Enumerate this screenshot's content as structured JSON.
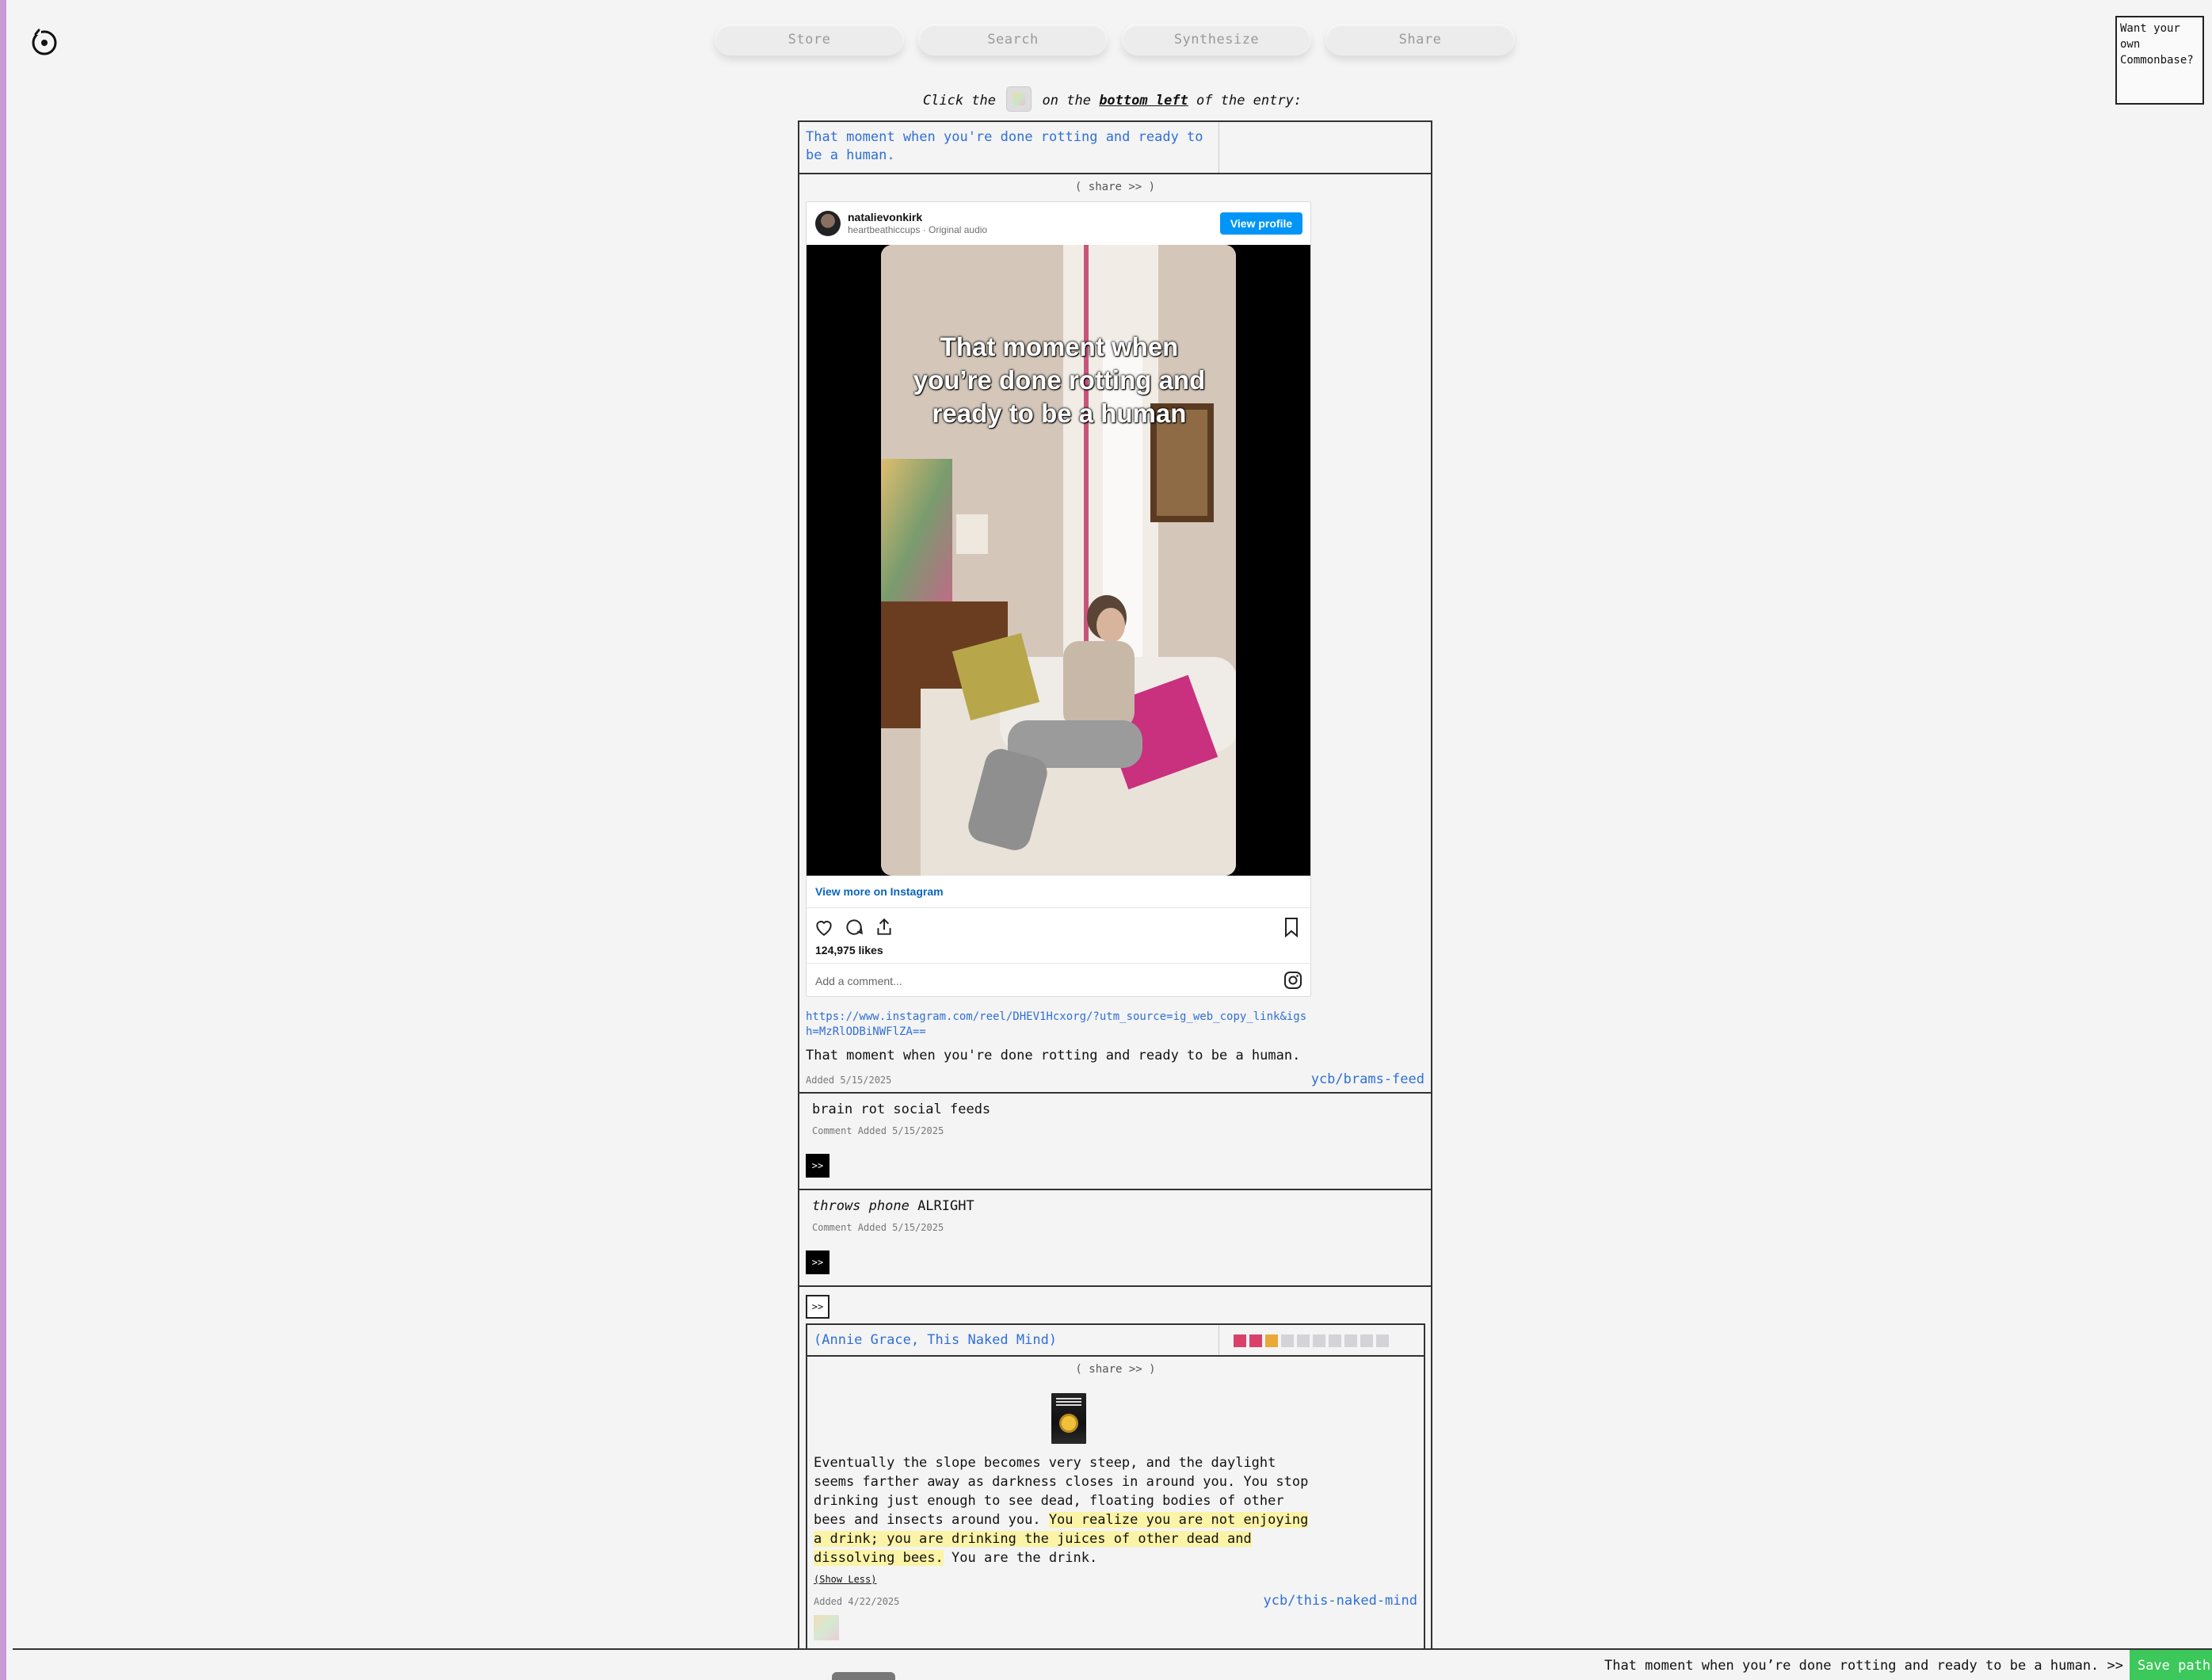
{
  "nav": {
    "tabs": [
      "Store",
      "Search",
      "Synthesize",
      "Share"
    ]
  },
  "promo": {
    "text": "Want your own Commonbase?"
  },
  "instruction": {
    "prefix": "Click the",
    "middle": "on the",
    "emphasis": "bottom left",
    "suffix": "of the entry:"
  },
  "entry": {
    "title": "That moment when you're done rotting and ready to be a human.",
    "share_label": "( share >> )",
    "instagram": {
      "username": "natalievonkirk",
      "subtitle": "heartbeathiccups · Original audio",
      "view_profile": "View profile",
      "overlay_text": "That moment when you’re done rotting and ready to be a human",
      "view_more": "View more on Instagram",
      "likes": "124,975 likes",
      "comment_placeholder": "Add a comment..."
    },
    "url": "https://www.instagram.com/reel/DHEV1Hcxorg/?utm_source=ig_web_copy_link&igsh=MzRlODBiNWFlZA==",
    "body": "That moment when you're done rotting and ready to be a human.",
    "added": "Added 5/15/2025",
    "tag": "ycb/brams-feed"
  },
  "comments": [
    {
      "text_em": "",
      "text": "brain rot social feeds",
      "meta": "Comment Added 5/15/2025",
      "go": ">>"
    },
    {
      "text_em": "throws phone",
      "text": " ALRIGHT",
      "meta": "Comment Added 5/15/2025",
      "go": ">>"
    }
  ],
  "arrow_label": ">>",
  "nested": {
    "title": "(Annie Grace, This Naked Mind)",
    "share_label": "( share >> )",
    "swatch_colors": [
      "#d9416a",
      "#d9416a",
      "#e8a93a",
      "#d3d3d8",
      "#d3d3d8",
      "#d3d3d8",
      "#d3d3d8",
      "#d3d3d8",
      "#d3d3d8",
      "#d3d3d8"
    ],
    "quote_plain": "Eventually the slope becomes very steep, and the daylight seems farther away as darkness closes in around you. You stop drinking just enough to see dead, floating bodies of other bees and insects around you. ",
    "quote_highlight": "You realize you are not enjoying a drink; you are drinking the juices of other dead and dissolving bees.",
    "quote_end": " You are the drink.",
    "show_less": "(Show Less)",
    "added": "Added 4/22/2025",
    "tag": "ycb/this-naked-mind"
  },
  "footer": {
    "path": "That moment when you’re done rotting and ready to be a human. >>",
    "save": "Save path"
  },
  "colors": {
    "link": "#2f6fd6",
    "save": "#3cc85a",
    "highlight": "#fbf3a6",
    "instagram_blue": "#0095f6"
  }
}
